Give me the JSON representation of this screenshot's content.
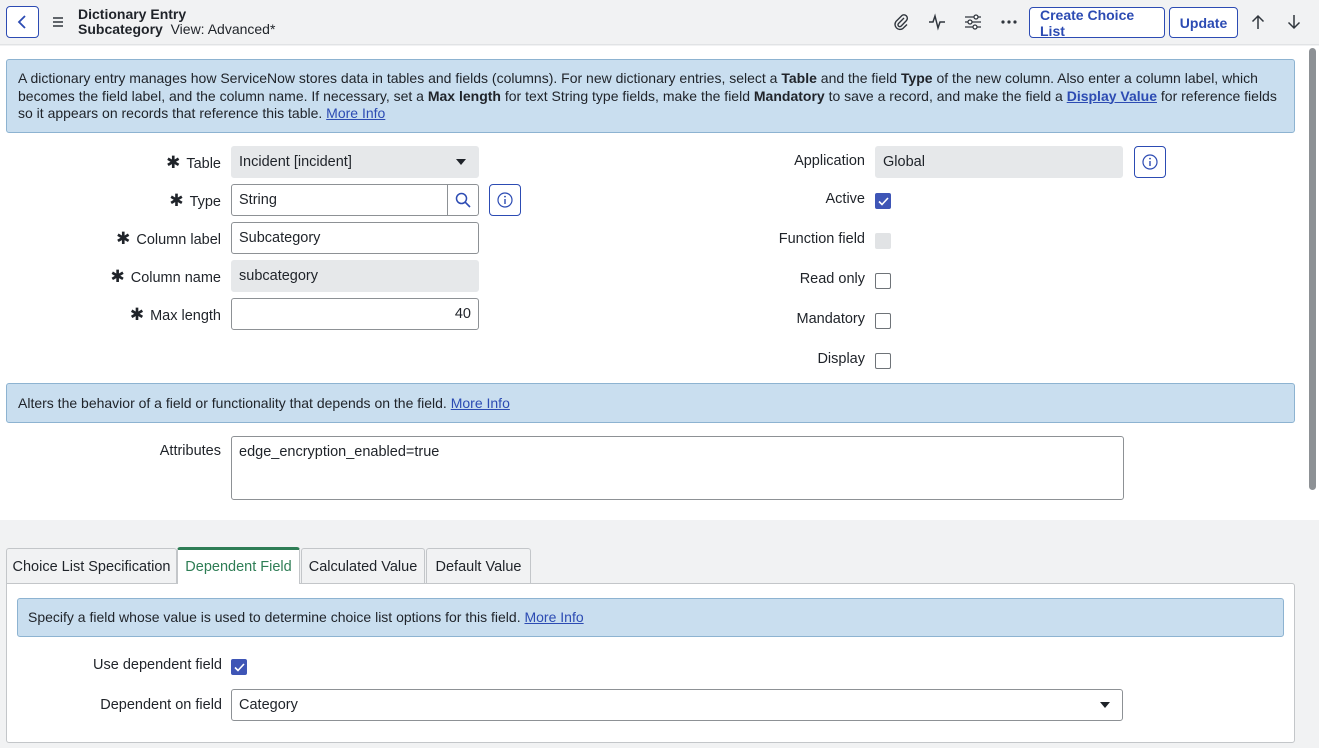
{
  "header": {
    "title": "Dictionary Entry",
    "record_name": "Subcategory",
    "view_label": "View: Advanced*",
    "buttons": {
      "create_choice_list": "Create Choice List",
      "update": "Update"
    },
    "icons": [
      "back-icon",
      "menu-icon",
      "paperclip-icon",
      "activity-icon",
      "settings-sliders-icon",
      "more-icon",
      "arrow-up-icon",
      "arrow-down-icon"
    ]
  },
  "intro": {
    "t1": "A dictionary entry manages how ServiceNow stores data in tables and fields (columns). For new dictionary entries, select a ",
    "b1": "Table",
    "t2": " and the field ",
    "b2": "Type",
    "t3": " of the new column. Also enter a column label, which becomes the field label, and the column name. If necessary, set a ",
    "b3": "Max length",
    "t4": " for text String type fields, make the field ",
    "b4": "Mandatory",
    "t5": " to save a record, and make the field a ",
    "link1": "Display Value",
    "t6": " for reference fields so it appears on records that reference this table. ",
    "link2": "More Info"
  },
  "form": {
    "required_marker": "✱",
    "table": {
      "label": "Table",
      "value": "Incident [incident]"
    },
    "type": {
      "label": "Type",
      "value": "String"
    },
    "column_label": {
      "label": "Column label",
      "value": "Subcategory"
    },
    "column_name": {
      "label": "Column name",
      "value": "subcategory"
    },
    "max_length": {
      "label": "Max length",
      "value": "40"
    },
    "application": {
      "label": "Application",
      "value": "Global"
    },
    "active": {
      "label": "Active",
      "checked": true
    },
    "function_field": {
      "label": "Function field",
      "checked": false,
      "disabled": true
    },
    "read_only": {
      "label": "Read only",
      "checked": false
    },
    "mandatory": {
      "label": "Mandatory",
      "checked": false
    },
    "display": {
      "label": "Display",
      "checked": false
    }
  },
  "attributes_info": {
    "text": "Alters the behavior of a field or functionality that depends on the field. ",
    "link": "More Info"
  },
  "attributes": {
    "label": "Attributes",
    "value": "edge_encryption_enabled=true"
  },
  "tabs": [
    {
      "label": "Choice List Specification",
      "active": false
    },
    {
      "label": "Dependent Field",
      "active": true
    },
    {
      "label": "Calculated Value",
      "active": false
    },
    {
      "label": "Default Value",
      "active": false
    }
  ],
  "dependent": {
    "info_text": "Specify a field whose value is used to determine choice list options for this field. ",
    "info_link": "More Info",
    "use_dependent": {
      "label": "Use dependent field",
      "checked": true
    },
    "dependent_on": {
      "label": "Dependent on field",
      "value": "Category"
    }
  },
  "colors": {
    "accent": "#2c4bb3",
    "info_bg": "#c9deef",
    "active_tab": "#2e7d55",
    "checkbox": "#3e55b6"
  }
}
